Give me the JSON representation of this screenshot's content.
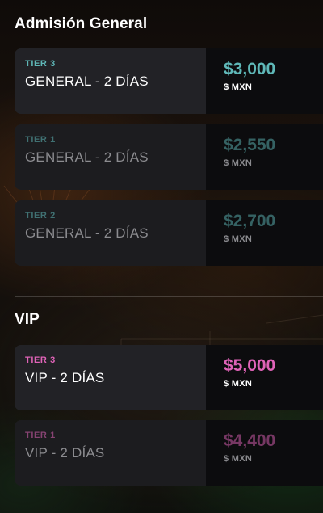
{
  "sections": [
    {
      "title": "Admisión General",
      "tickets": [
        {
          "tier": "TIER 3",
          "name": "GENERAL - 2 DÍAS",
          "price": "$3,000",
          "currency": "$ MXN",
          "available": true
        },
        {
          "tier": "TIER 1",
          "name": "GENERAL - 2 DÍAS",
          "price": "$2,550",
          "currency": "$ MXN",
          "available": false
        },
        {
          "tier": "TIER 2",
          "name": "GENERAL - 2 DÍAS",
          "price": "$2,700",
          "currency": "$ MXN",
          "available": false
        }
      ]
    },
    {
      "title": "VIP",
      "tickets": [
        {
          "tier": "TIER 3",
          "name": "VIP - 2 DÍAS",
          "price": "$5,000",
          "currency": "$ MXN",
          "available": true
        },
        {
          "tier": "TIER 1",
          "name": "VIP - 2 DÍAS",
          "price": "$4,400",
          "currency": "$ MXN",
          "available": false
        }
      ]
    }
  ],
  "colors": {
    "general_accent": "#5fb8b8",
    "vip_accent": "#e063b8"
  }
}
